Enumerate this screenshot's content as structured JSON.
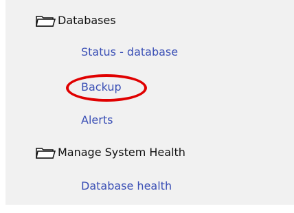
{
  "tree": {
    "groups": [
      {
        "label": "Databases",
        "icon": "folder-icon",
        "items": [
          {
            "label": "Status - database"
          },
          {
            "label": "Backup",
            "highlighted": true
          },
          {
            "label": "Alerts"
          }
        ]
      },
      {
        "label": "Manage System Health",
        "icon": "folder-icon",
        "items": [
          {
            "label": "Database health"
          }
        ]
      }
    ]
  },
  "colors": {
    "panel_background": "#f1f1f1",
    "link": "#3a4fb5",
    "highlight_circle": "#e00000",
    "folder_text": "#111111"
  }
}
